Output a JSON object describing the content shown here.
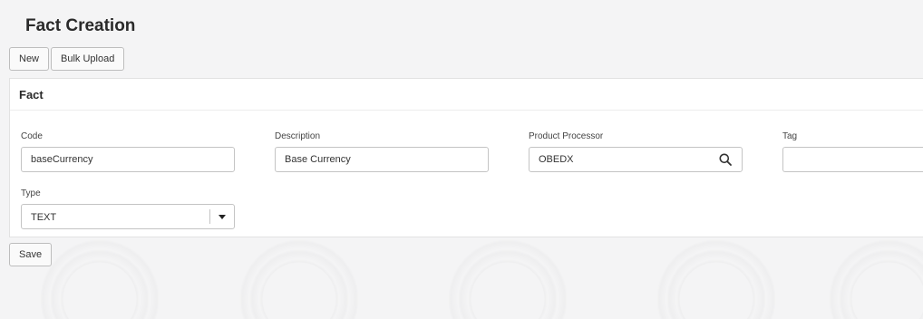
{
  "page": {
    "title": "Fact Creation"
  },
  "toolbar": {
    "new_label": "New",
    "bulk_upload_label": "Bulk Upload"
  },
  "fact": {
    "section_title": "Fact",
    "fields": {
      "code": {
        "label": "Code",
        "value": "baseCurrency"
      },
      "description": {
        "label": "Description",
        "value": "Base Currency"
      },
      "product_processor": {
        "label": "Product Processor",
        "value": "OBEDX",
        "icon": "search-icon"
      },
      "tag": {
        "label": "Tag",
        "value": ""
      },
      "type": {
        "label": "Type",
        "value": "TEXT",
        "icon": "chevron-down-icon"
      }
    }
  },
  "actions": {
    "save_label": "Save"
  }
}
